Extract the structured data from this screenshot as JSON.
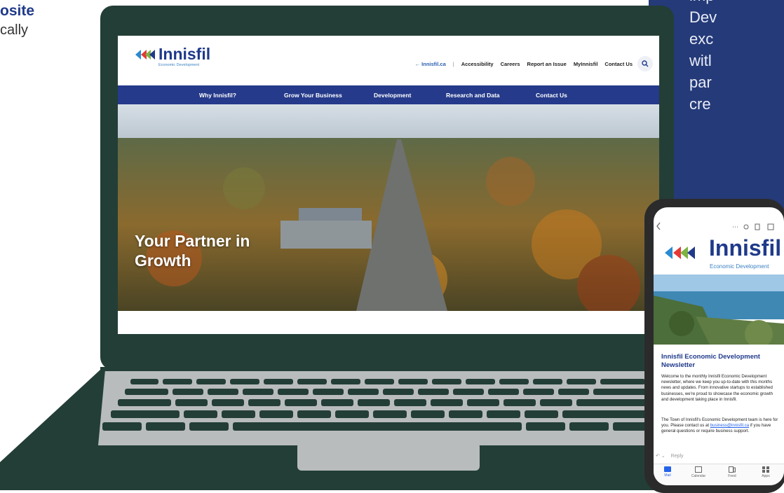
{
  "left_text": {
    "title_fragment": "osite",
    "subtitle_fragment": "cally"
  },
  "right_text": {
    "lines": [
      "imp",
      "Dev",
      "exc",
      "witl",
      "par",
      "cre"
    ]
  },
  "website": {
    "logo": {
      "name": "Innisfil",
      "tagline": "Economic Development"
    },
    "utility_nav": {
      "back_link": "← Innisfil.ca",
      "separator": "|",
      "items": [
        "Accessibility",
        "Careers",
        "Report an Issue",
        "MyInnisfil",
        "Contact Us"
      ]
    },
    "main_nav": [
      "Why Innisfil?",
      "Grow Your Business",
      "Development",
      "Research and Data",
      "Contact Us"
    ],
    "hero": {
      "headline": "Your Partner in Growth"
    }
  },
  "email": {
    "logo": {
      "name": "Innisfil",
      "tagline": "Economic Development"
    },
    "title": "Innisfil Economic Development Newsletter",
    "paragraph1": "Welcome to the monthly Innisfil Economic Development newsletter, where we keep you up-to-date with this months news and updates. From innovative startups to established businesses, we're proud to showcase the economic growth and development taking place in Innisfil.",
    "paragraph2_before": "The Town of Innisfil's Economic Development team is here for you. Please contact us at ",
    "paragraph2_link": "business@innisfil.ca",
    "paragraph2_after": " if you have general questions or require business support.",
    "reply_label": "Reply",
    "tabs": [
      "Mail",
      "Calendar",
      "Feed",
      "Apps"
    ]
  },
  "colors": {
    "brand_navy": "#253a8a",
    "laptop_body": "#233e36",
    "panel_bg": "#253a78"
  }
}
